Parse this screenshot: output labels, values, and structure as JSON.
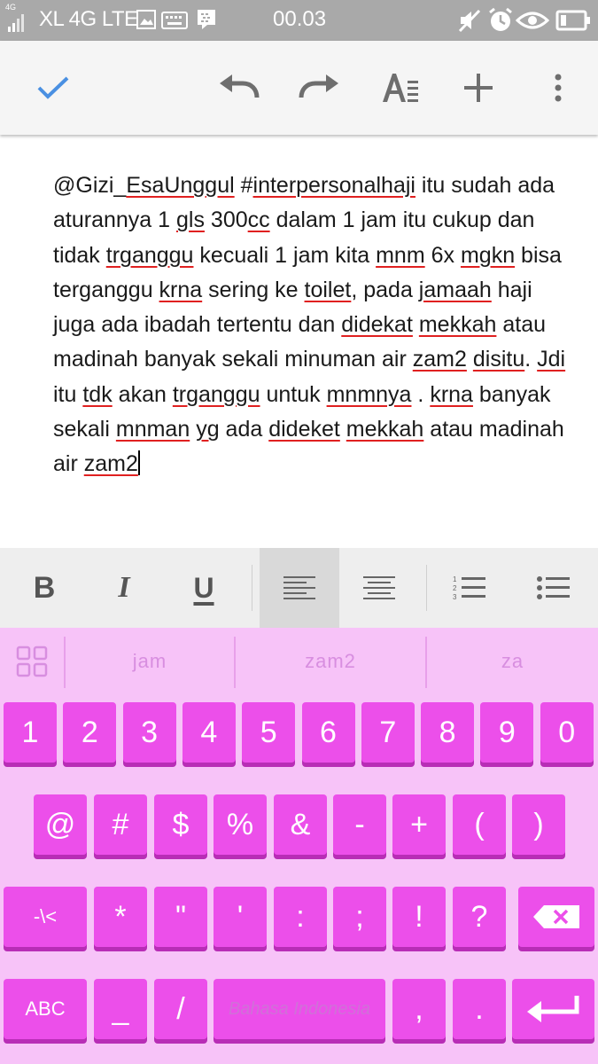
{
  "status_bar": {
    "network_type": "4G",
    "carrier": "XL 4G LTE",
    "time": "00.03",
    "icons": [
      "signal-icon",
      "image-notification-icon",
      "keyboard-notification-icon",
      "bbm-icon",
      "mute-icon",
      "alarm-icon",
      "eye-icon",
      "battery-icon"
    ]
  },
  "toolbar": {
    "icons": [
      "check-icon",
      "undo-icon",
      "redo-icon",
      "text-format-icon",
      "add-icon",
      "more-vert-icon"
    ],
    "accent": "#4a90e2"
  },
  "document": {
    "segments": [
      {
        "t": "@Gizi_",
        "s": false
      },
      {
        "t": "EsaUnggul",
        "s": true
      },
      {
        "t": " #",
        "s": false
      },
      {
        "t": "interpersonalhaji",
        "s": true
      },
      {
        "t": " itu sudah ada aturannya 1 ",
        "s": false
      },
      {
        "t": "gls",
        "s": true
      },
      {
        "t": " 300",
        "s": false
      },
      {
        "t": "cc",
        "s": true
      },
      {
        "t": " dalam 1 jam itu cukup dan tidak ",
        "s": false
      },
      {
        "t": "trganggu",
        "s": true
      },
      {
        "t": " kecuali 1 jam kita ",
        "s": false
      },
      {
        "t": "mnm",
        "s": true
      },
      {
        "t": " 6x ",
        "s": false
      },
      {
        "t": "mgkn",
        "s": true
      },
      {
        "t": " bisa terganggu ",
        "s": false
      },
      {
        "t": "krna",
        "s": true
      },
      {
        "t": " sering ke ",
        "s": false
      },
      {
        "t": "toilet",
        "s": true
      },
      {
        "t": ", pada ",
        "s": false
      },
      {
        "t": "jamaah",
        "s": true
      },
      {
        "t": " haji juga ada ibadah tertentu dan ",
        "s": false
      },
      {
        "t": "didekat",
        "s": true
      },
      {
        "t": " ",
        "s": false
      },
      {
        "t": "mekkah",
        "s": true
      },
      {
        "t": " atau madinah banyak sekali minuman air ",
        "s": false
      },
      {
        "t": "zam2",
        "s": true
      },
      {
        "t": " ",
        "s": false
      },
      {
        "t": "disitu",
        "s": true
      },
      {
        "t": ". ",
        "s": false
      },
      {
        "t": "Jdi",
        "s": true
      },
      {
        "t": " itu ",
        "s": false
      },
      {
        "t": "tdk",
        "s": true
      },
      {
        "t": " akan ",
        "s": false
      },
      {
        "t": "trganggu",
        "s": true
      },
      {
        "t": " untuk ",
        "s": false
      },
      {
        "t": "mnmnya",
        "s": true
      },
      {
        "t": " . ",
        "s": false
      },
      {
        "t": "krna",
        "s": true
      },
      {
        "t": " banyak sekali ",
        "s": false
      },
      {
        "t": "mnman",
        "s": true
      },
      {
        "t": " ",
        "s": false
      },
      {
        "t": "yg",
        "s": true
      },
      {
        "t": " ada ",
        "s": false
      },
      {
        "t": "dideket",
        "s": true
      },
      {
        "t": " ",
        "s": false
      },
      {
        "t": "mekkah",
        "s": true
      },
      {
        "t": " atau madinah air ",
        "s": false
      },
      {
        "t": "zam2",
        "s": true
      }
    ],
    "spellcheck_color": "#e02020"
  },
  "format_bar": {
    "bold_label": "B",
    "italic_label": "I",
    "underline_label": "U",
    "icons": [
      "bold-icon",
      "italic-icon",
      "underline-icon",
      "align-left-icon",
      "align-center-icon",
      "numbered-list-icon",
      "bulleted-list-icon"
    ],
    "active": "align-left"
  },
  "keyboard": {
    "suggestions": [
      "jam",
      "zam2",
      "za"
    ],
    "row1": [
      "1",
      "2",
      "3",
      "4",
      "5",
      "6",
      "7",
      "8",
      "9",
      "0"
    ],
    "row2": [
      "@",
      "#",
      "$",
      "%",
      "&",
      "-",
      "+",
      "(",
      ")"
    ],
    "row3": [
      "-\\<",
      "*",
      "\"",
      "'",
      ":",
      ";",
      "!",
      "?"
    ],
    "row4": {
      "abc": "ABC",
      "underscore": "_",
      "slash": "/",
      "space": "Bahasa Indonesia",
      "comma": ",",
      "period": "."
    },
    "key_color": "#ec4fea",
    "background": "#f7c3f8"
  }
}
